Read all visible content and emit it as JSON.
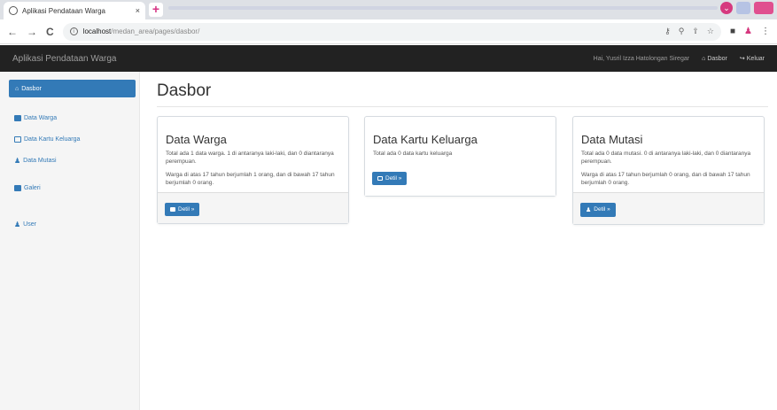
{
  "browser": {
    "tab_title": "Aplikasi Pendataan Warga",
    "tab_close": "×",
    "new_tab": "+",
    "url_host": "localhost",
    "url_path": "/medan_area/pages/dasbor/",
    "back": "←",
    "forward": "→",
    "reload": "C"
  },
  "navbar": {
    "brand": "Aplikasi Pendataan Warga",
    "greeting": "Hai, Yusril Izza Hatolongan Siregar",
    "dasbor_link": "Dasbor",
    "keluar_link": "Keluar"
  },
  "sidebar": {
    "active": "Dasbor",
    "items": [
      {
        "label": "Data Warga"
      },
      {
        "label": "Data Kartu Keluarga"
      },
      {
        "label": "Data Mutasi"
      },
      {
        "label": "Galeri"
      },
      {
        "label": "User"
      }
    ]
  },
  "main": {
    "title": "Dasbor",
    "cards": [
      {
        "title": "Data Warga",
        "text1": "Total ada 1 data warga. 1 di antaranya laki-laki, dan 0 diantaranya perempuan.",
        "text2": "Warga di atas 17 tahun berjumlah 1 orang, dan di bawah 17 tahun berjumlah 0 orang.",
        "button": "Detil »"
      },
      {
        "title": "Data Kartu Keluarga",
        "text1": "Total ada 0 data kartu keluarga",
        "button": "Detil »"
      },
      {
        "title": "Data Mutasi",
        "text1": "Total ada 0 data mutasi. 0 di antaranya laki-laki, dan 0 diantaranya perempuan.",
        "text2": "Warga di atas 17 tahun berjumlah 0 orang, dan di bawah 17 tahun berjumlah 0 orang.",
        "button": "Detil »"
      }
    ]
  },
  "colors": {
    "primary": "#337ab7",
    "navbar_bg": "#222222"
  }
}
